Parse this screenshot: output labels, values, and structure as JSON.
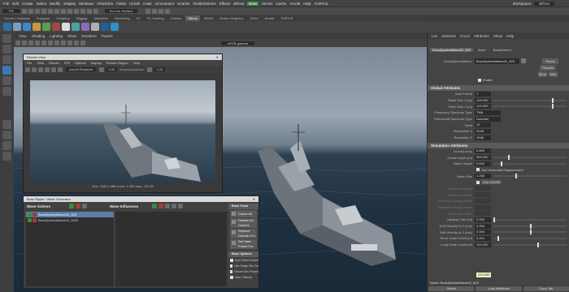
{
  "menubar": {
    "items": [
      "File",
      "Edit",
      "Create",
      "Select",
      "Modify",
      "Display",
      "Windows",
      "nParticles",
      "Fields",
      "nCloth",
      "nHair",
      "nConstraint",
      "nCache",
      "Fields/Solvers",
      "Effects",
      "Bifrost",
      "Boss",
      "MASH",
      "Cache",
      "Arnold",
      "Help",
      "TURTLE"
    ],
    "workspace_label": "Workspace:",
    "workspace_value": "Bifrost"
  },
  "toolbar": {
    "mode": "FX",
    "no_live_surface": "No Live Surface"
  },
  "shelf": {
    "tabs": [
      "Curves / Surfaces",
      "Polygons",
      "Sculpting",
      "Rigging",
      "Animation",
      "Rendering",
      "FX",
      "FX Caching",
      "Custom",
      "Bifrost",
      "MASH",
      "Motion Graphics",
      "XGen",
      "Arnold",
      "TURTLE"
    ],
    "active_tab": "Bifrost"
  },
  "viewport": {
    "menu": [
      "View",
      "Shading",
      "Lighting",
      "Show",
      "Renderer",
      "Panels"
    ],
    "color_space": "sRGB gamma"
  },
  "render_view": {
    "title": "Render View",
    "menu": [
      "File",
      "View",
      "Render",
      "IPR",
      "Options",
      "Display",
      "Render Region",
      "Help"
    ],
    "renderer": "Arnold Renderer",
    "exposure": "0.00",
    "gamma": "1.00",
    "status": "size: 1280 x 886  zoom: 1.000  arby: 224.30"
  },
  "boss": {
    "title": "Boss Ripple / Wave Generator",
    "solvers_label": "Wave Solvers",
    "influences_label": "Wave Influences",
    "solvers": [
      "BossSpectralWave02_525",
      "BossSpectralWave03_5000"
    ],
    "tools_header": "Boss Tools",
    "tools": [
      "Cache All",
      "Disable All Caches",
      "Replace Domain For All",
      "Set Start Frame For All"
    ],
    "options_header": "Boss Options",
    "options": [
      "Auto Select Nodes",
      "Use Single Sim Domain",
      "Reuse Geo Properties",
      "Auto Cleanup"
    ]
  },
  "attr": {
    "menu": [
      "List",
      "Selected",
      "Focus",
      "Attributes",
      "Show",
      "Help"
    ],
    "tabs": [
      "BossSpectralWave02_525",
      "time1",
      "BossSolver1"
    ],
    "node_label": "BossSpectralWave:",
    "node_value": "BossSpectralWave02_525",
    "focus": "Focus",
    "presets": "Presets",
    "show": "Show",
    "hide": "Hide",
    "enable_label": "Enable",
    "global_header": "Global Attributes",
    "global": [
      {
        "label": "Start Frame",
        "value": "1"
      },
      {
        "label": "Patch Size X (m)",
        "value": "125.000"
      },
      {
        "label": "Patch Size Z (m)",
        "value": "125.000"
      },
      {
        "label": "Frequency Spectrum Type",
        "value": "TMA"
      },
      {
        "label": "Directional Spectrum Type",
        "value": "Donelan"
      },
      {
        "label": "Seed",
        "value": "10"
      },
      {
        "label": "Resolution X",
        "value": "2048"
      },
      {
        "label": "Resolution Z",
        "value": "2048"
      }
    ],
    "sim_header": "Simulation Attributes",
    "sim": [
      {
        "label": "Gravity (m/s)",
        "value": "9.800"
      },
      {
        "label": "Ocean Depth (m)",
        "value": "500.000"
      },
      {
        "label": "Wave Height",
        "value": "0.600"
      }
    ],
    "horiz_disp": "Use Horizontal Displacement",
    "wave_size_label": "Wave Size",
    "wave_size": "1.250",
    "use_cutoffs": "Use Cutoffs",
    "dim_rows": [
      "Reflection Height",
      "Reflection Wave",
      "Reflection Decay Width",
      "Reflection Decay Power",
      "Reflection Offset"
    ],
    "caps": [
      {
        "label": "Capillary Size (m)",
        "value": "0.000"
      },
      {
        "label": "Drift Velocity in X (m/s)",
        "value": "0.000"
      },
      {
        "label": "Drift Velocity in Z (m/s)",
        "value": "0.000"
      },
      {
        "label": "Short Scale Cutoff (m)",
        "value": "0.001"
      },
      {
        "label": "Long Scale Cutoff (m)",
        "value": "100.000"
      }
    ],
    "tooltip": "224.000",
    "notes_label": "Notes: BossSpectralWave02_525",
    "bottom": [
      "Select",
      "Load Attributes",
      "Copy Tab"
    ]
  }
}
